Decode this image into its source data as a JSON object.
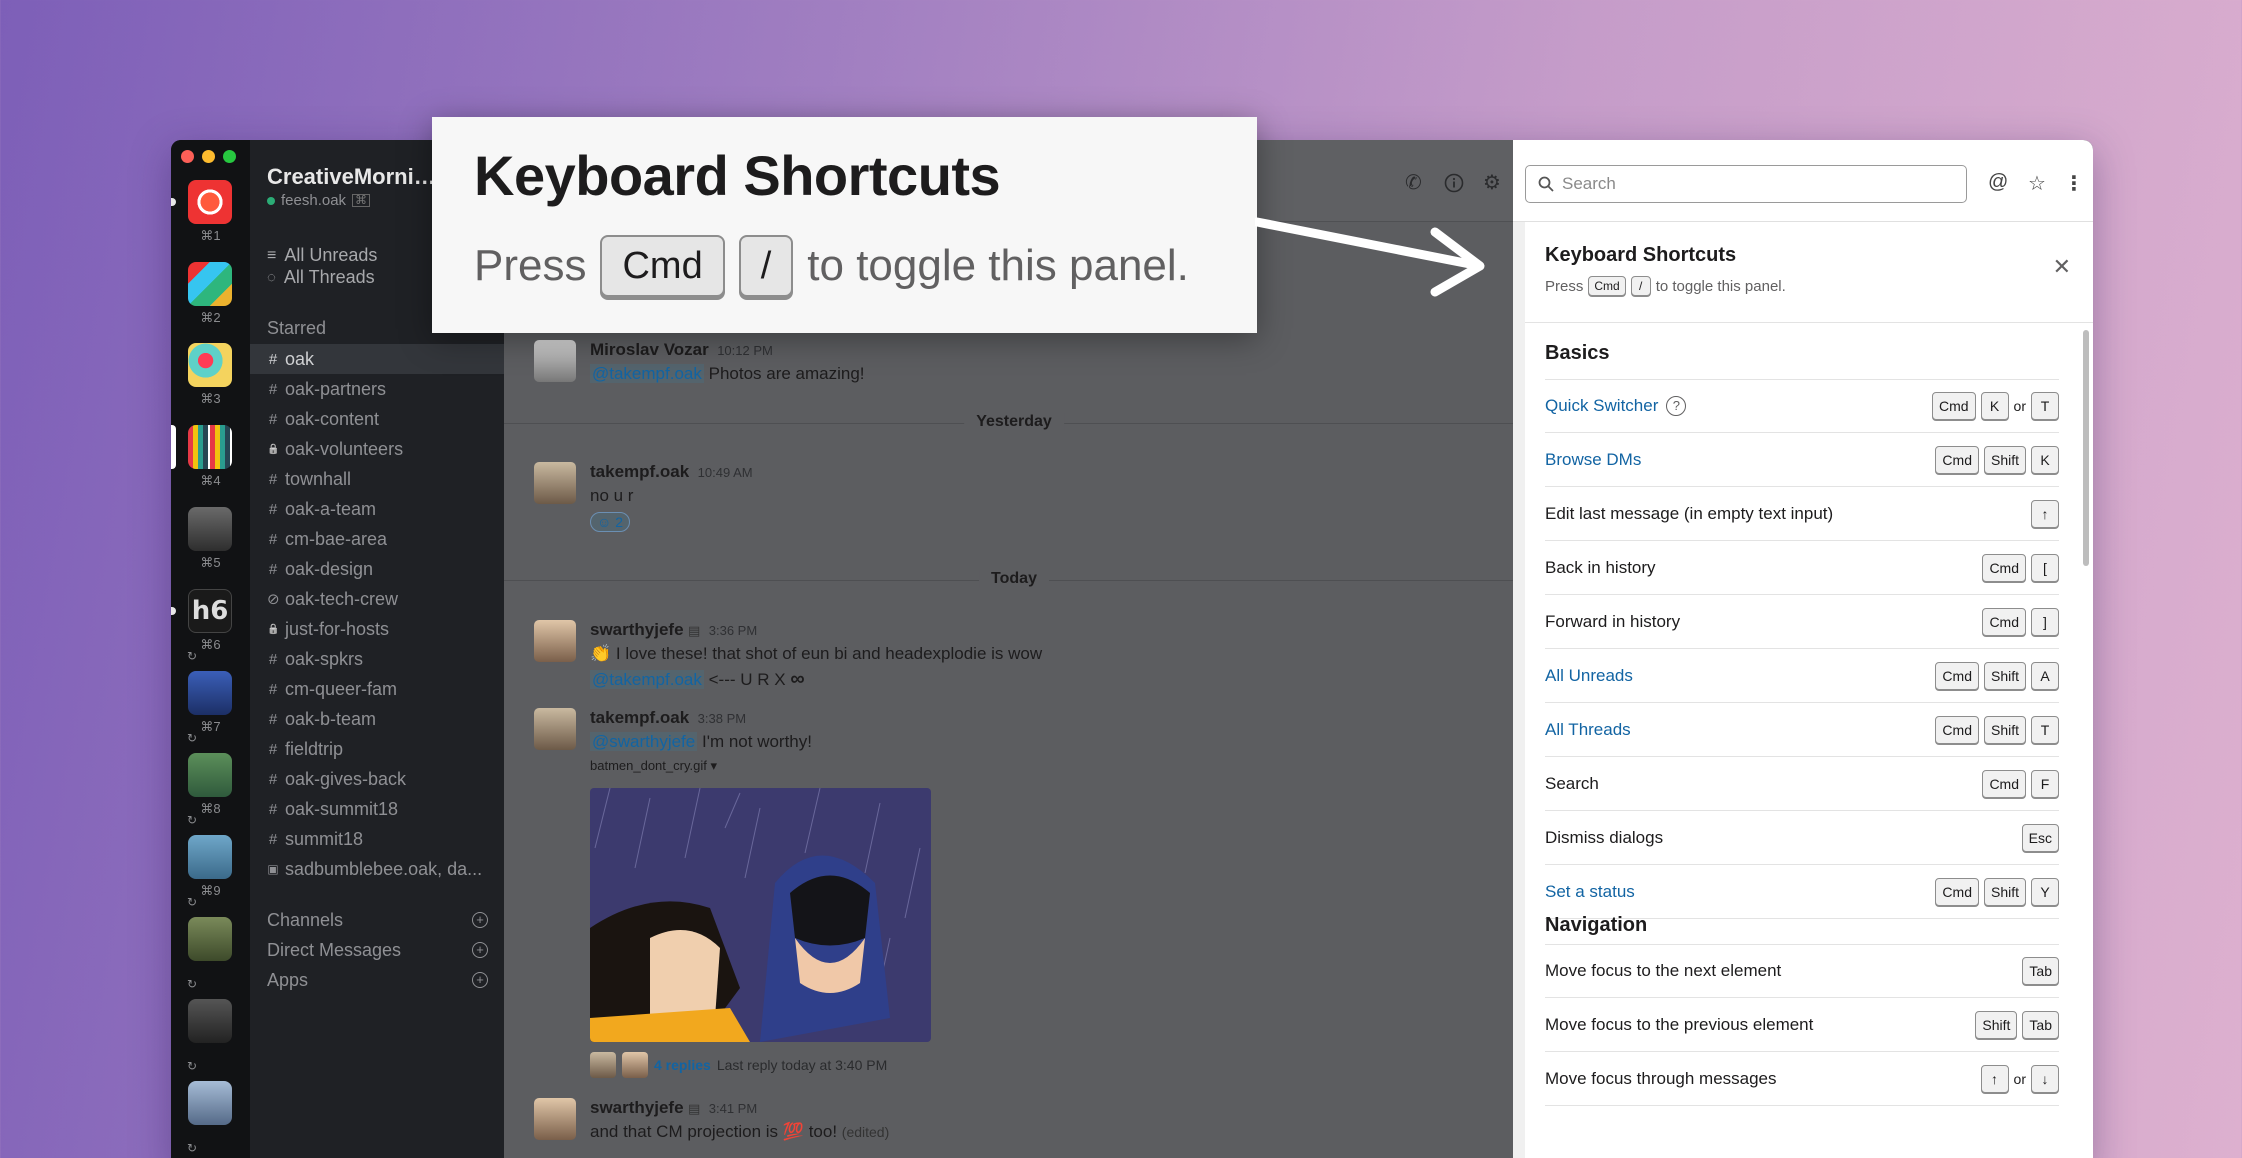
{
  "callout": {
    "title": "Keyboard Shortcuts",
    "press": "Press",
    "key1": "Cmd",
    "key2": "/",
    "suffix": "to toggle this panel."
  },
  "rail": {
    "workspaces": [
      {
        "shortcut": "⌘1"
      },
      {
        "shortcut": "⌘2"
      },
      {
        "shortcut": "⌘3"
      },
      {
        "shortcut": "⌘4"
      },
      {
        "shortcut": "⌘5"
      },
      {
        "shortcut": "⌘6"
      },
      {
        "shortcut": "⌘7"
      },
      {
        "shortcut": "⌘8"
      },
      {
        "shortcut": "⌘9"
      }
    ],
    "h6_logo": "h6"
  },
  "sidebar": {
    "team_name": "CreativeMornin...",
    "user": "feesh.oak",
    "all_unreads": "All Unreads",
    "all_threads": "All Threads",
    "starred": "Starred",
    "channels": [
      {
        "prefix": "#",
        "name": "oak",
        "active": true
      },
      {
        "prefix": "#",
        "name": "oak-partners"
      },
      {
        "prefix": "#",
        "name": "oak-content"
      },
      {
        "prefix": "lock",
        "name": "oak-volunteers"
      },
      {
        "prefix": "#",
        "name": "townhall"
      },
      {
        "prefix": "#",
        "name": "oak-a-team"
      },
      {
        "prefix": "#",
        "name": "cm-bae-area"
      },
      {
        "prefix": "#",
        "name": "oak-design"
      },
      {
        "prefix": "link",
        "name": "oak-tech-crew"
      },
      {
        "prefix": "lock",
        "name": "just-for-hosts"
      },
      {
        "prefix": "#",
        "name": "oak-spkrs"
      },
      {
        "prefix": "#",
        "name": "cm-queer-fam"
      },
      {
        "prefix": "#",
        "name": "oak-b-team"
      },
      {
        "prefix": "#",
        "name": "fieldtrip"
      },
      {
        "prefix": "#",
        "name": "oak-gives-back"
      },
      {
        "prefix": "#",
        "name": "oak-summit18"
      },
      {
        "prefix": "#",
        "name": "summit18"
      },
      {
        "prefix": "dm",
        "name": "sadbumblebee.oak, da..."
      }
    ],
    "sections": {
      "channels": "Channels",
      "direct_messages": "Direct Messages",
      "apps": "Apps"
    }
  },
  "messages": {
    "m1": {
      "author": "Miroslav Vozar",
      "time": "10:12 PM",
      "mention": "@takempf.oak",
      "text": "Photos are amazing!"
    },
    "day1": "Yesterday",
    "m2": {
      "author": "takempf.oak",
      "time": "10:49 AM",
      "text": "no u r",
      "reaction_count": "2"
    },
    "day2": "Today",
    "m3": {
      "author": "swarthyjefe",
      "time": "3:36 PM",
      "text": "I love these! that shot of eun bi and headexplodie is wow",
      "mention": "@takempf.oak",
      "text2": "<--- U R X",
      "infinity": "∞"
    },
    "m4": {
      "author": "takempf.oak",
      "time": "3:38 PM",
      "mention": "@swarthyjefe",
      "text": "I'm not worthy!",
      "file_name": "batmen_dont_cry.gif ▾",
      "replies": "4 replies",
      "last_reply": "Last reply today at 3:40 PM"
    },
    "m5": {
      "author": "swarthyjefe",
      "time": "3:41 PM",
      "text": "and that CM projection is",
      "emoji": "💯",
      "text_after": "too!",
      "edited": "(edited)"
    }
  },
  "search": {
    "placeholder": "Search"
  },
  "panel": {
    "title": "Keyboard Shortcuts",
    "press": "Press",
    "key1": "Cmd",
    "key2": "/",
    "suffix": "to toggle this panel.",
    "basics_title": "Basics",
    "basics": [
      {
        "label": "Quick Switcher",
        "link": true,
        "help": true,
        "keys": [
          "Cmd",
          "K",
          "or",
          "T"
        ]
      },
      {
        "label": "Browse DMs",
        "link": true,
        "keys": [
          "Cmd",
          "Shift",
          "K"
        ]
      },
      {
        "label": "Edit last message (in empty text input)",
        "keys": [
          "↑"
        ]
      },
      {
        "label": "Back in history",
        "keys": [
          "Cmd",
          "["
        ]
      },
      {
        "label": "Forward in history",
        "keys": [
          "Cmd",
          "]"
        ]
      },
      {
        "label": "All Unreads",
        "link": true,
        "keys": [
          "Cmd",
          "Shift",
          "A"
        ]
      },
      {
        "label": "All Threads",
        "link": true,
        "keys": [
          "Cmd",
          "Shift",
          "T"
        ]
      },
      {
        "label": "Search",
        "keys": [
          "Cmd",
          "F"
        ]
      },
      {
        "label": "Dismiss dialogs",
        "keys": [
          "Esc"
        ]
      },
      {
        "label": "Set a status",
        "link": true,
        "keys": [
          "Cmd",
          "Shift",
          "Y"
        ]
      }
    ],
    "navigation_title": "Navigation",
    "navigation": [
      {
        "label": "Move focus to the next element",
        "keys": [
          "Tab"
        ]
      },
      {
        "label": "Move focus to the previous element",
        "keys": [
          "Shift",
          "Tab"
        ]
      },
      {
        "label": "Move focus through messages",
        "keys": [
          "↑",
          "or",
          "↓"
        ]
      }
    ]
  }
}
